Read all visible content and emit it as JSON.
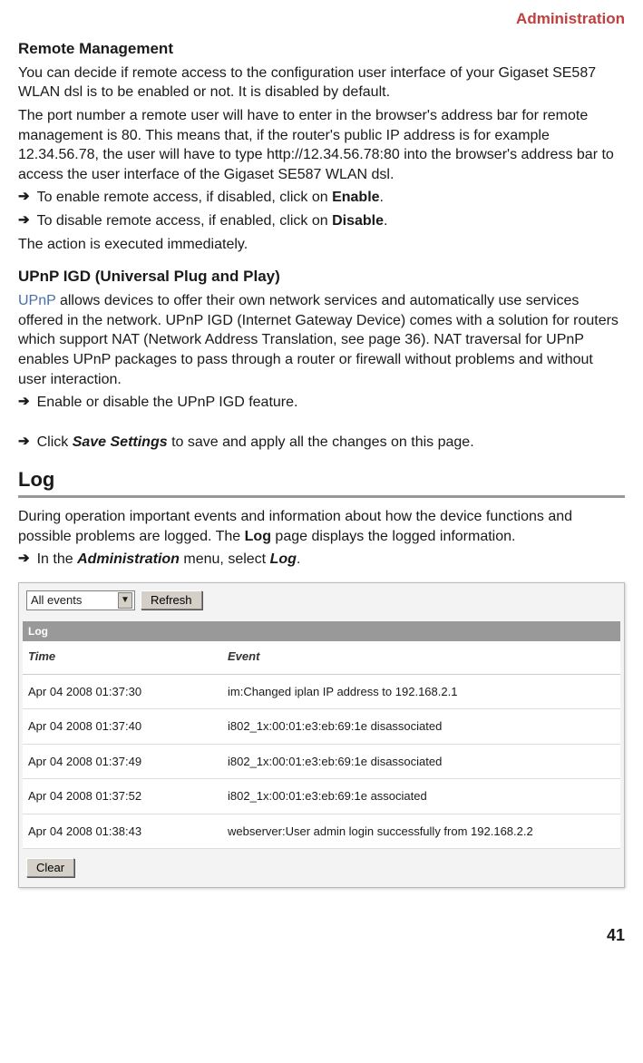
{
  "header": {
    "title": "Administration"
  },
  "remote_management": {
    "title": "Remote Management",
    "p1": "You can decide if remote access to the configuration user interface of your Gigaset SE587 WLAN dsl is to be enabled or not. It is disabled by default.",
    "p2": "The port number a remote user will have to enter in the browser's address bar for remote management is 80. This means that, if the router's public IP address is for example 12.34.56.78, the user will have to type http://12.34.56.78:80 into the browser's address bar to access the user interface of the Gigaset SE587 WLAN dsl.",
    "b1_pre": "To enable remote access, if disabled, click on ",
    "b1_bold": "Enable",
    "b2_pre": "To disable remote access, if enabled, click on ",
    "b2_bold": "Disable",
    "p3": "The action is executed immediately."
  },
  "upnp": {
    "title": "UPnP IGD (Universal Plug and Play)",
    "link_word": "UPnP",
    "p1_rest": " allows devices to offer their own network services and automatically use services offered in the network. UPnP IGD (Internet Gateway Device) comes with a solution for routers which support NAT (Network Address Translation, see page 36). NAT traversal for UPnP enables UPnP packages to pass through a router or firewall without problems and without user interaction.",
    "b1": "Enable or disable the UPnP IGD feature."
  },
  "save": {
    "pre": "Click ",
    "bold": "Save Settings",
    "post": " to save and apply all the changes on this page."
  },
  "log": {
    "title": "Log",
    "p1_pre": "During operation important events and information about how the device functions and possible problems are logged. The ",
    "p1_bold": "Log",
    "p1_post": " page displays the logged information.",
    "b1_pre": "In the ",
    "b1_bold1": "Administration",
    "b1_mid": " menu, select ",
    "b1_bold2": "Log",
    "b1_end": "."
  },
  "screenshot": {
    "filter_value": "All events",
    "refresh_label": "Refresh",
    "panel_label": "Log",
    "columns": {
      "time": "Time",
      "event": "Event"
    },
    "rows": [
      {
        "time": "Apr 04 2008 01:37:30",
        "event": "im:Changed iplan IP address to 192.168.2.1"
      },
      {
        "time": "Apr 04 2008 01:37:40",
        "event": "i802_1x:00:01:e3:eb:69:1e disassociated"
      },
      {
        "time": "Apr 04 2008 01:37:49",
        "event": "i802_1x:00:01:e3:eb:69:1e disassociated"
      },
      {
        "time": "Apr 04 2008 01:37:52",
        "event": "i802_1x:00:01:e3:eb:69:1e associated"
      },
      {
        "time": "Apr 04 2008 01:38:43",
        "event": "webserver:User admin login successfully from 192.168.2.2"
      }
    ],
    "clear_label": "Clear"
  },
  "page_number": "41"
}
